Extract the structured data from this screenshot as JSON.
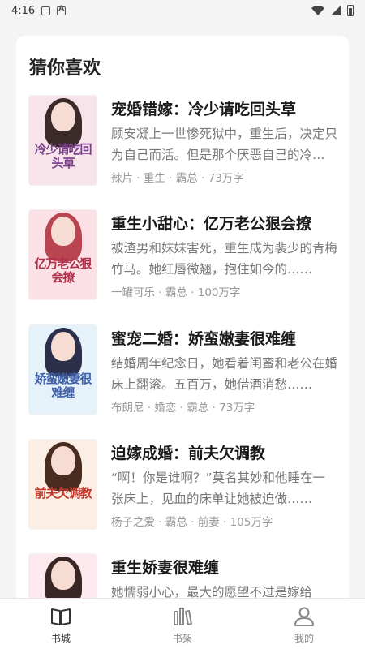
{
  "status_bar": {
    "time": "4:16"
  },
  "section": {
    "title": "猜你喜欢"
  },
  "books": [
    {
      "title": "宠婚错嫁：冷少请吃回头草",
      "description": "顾安凝上一世惨死狱中，重生后，决定只为自己而活。但是那个厌恶自己的冷少却……",
      "meta": "辣片 · 重生 · 霸总 · 73万字",
      "cover_text": "冷少请吃回头草",
      "cover_colors": {
        "bg": "#f7e3ea",
        "hair": "#3a2a2a",
        "text": "#7a3f8c"
      }
    },
    {
      "title": "重生小甜心：亿万老公狠会撩",
      "description": "被渣男和妹妹害死，重生成为裴少的青梅竹马。她红唇微翘，抱住如今的……",
      "meta": "一罐可乐 · 霸总 · 100万字",
      "cover_text": "亿万老公狠会撩",
      "cover_colors": {
        "bg": "#fbe1e6",
        "hair": "#b8454f",
        "text": "#b0304a"
      }
    },
    {
      "title": "蜜宠二婚：娇蛮嫩妻很难缠",
      "description": "结婚周年纪念日，她看着闺蜜和老公在婚床上翻滚。五百万，她借酒消愁……",
      "meta": "布朗尼 · 婚恋 · 霸总 · 73万字",
      "cover_text": "娇蛮嫩妻很难缠",
      "cover_colors": {
        "bg": "#e6f2fa",
        "hair": "#2c2f4a",
        "text": "#3d5fa8"
      }
    },
    {
      "title": "迫嫁成婚：前夫欠调教",
      "description": "“啊！你是谁啊？”莫名其妙和他睡在一张床上，见血的床单让她被迫做……",
      "meta": "杨子之爱 · 霸总 · 前妻 · 105万字",
      "cover_text": "前夫欠调教",
      "cover_colors": {
        "bg": "#fbeee4",
        "hair": "#4a2b20",
        "text": "#c0392b"
      }
    },
    {
      "title": "重生娇妻很难缠",
      "description": "她懦弱小心，最大的愿望不过是嫁给他……",
      "meta": "",
      "cover_text": "",
      "cover_colors": {
        "bg": "#fde8ee",
        "hair": "#3b2626",
        "text": "#b03060"
      }
    }
  ],
  "tabs": [
    {
      "label": "书城",
      "icon": "book-open-icon",
      "active": true
    },
    {
      "label": "书架",
      "icon": "bookshelf-icon",
      "active": false
    },
    {
      "label": "我的",
      "icon": "user-icon",
      "active": false
    }
  ]
}
